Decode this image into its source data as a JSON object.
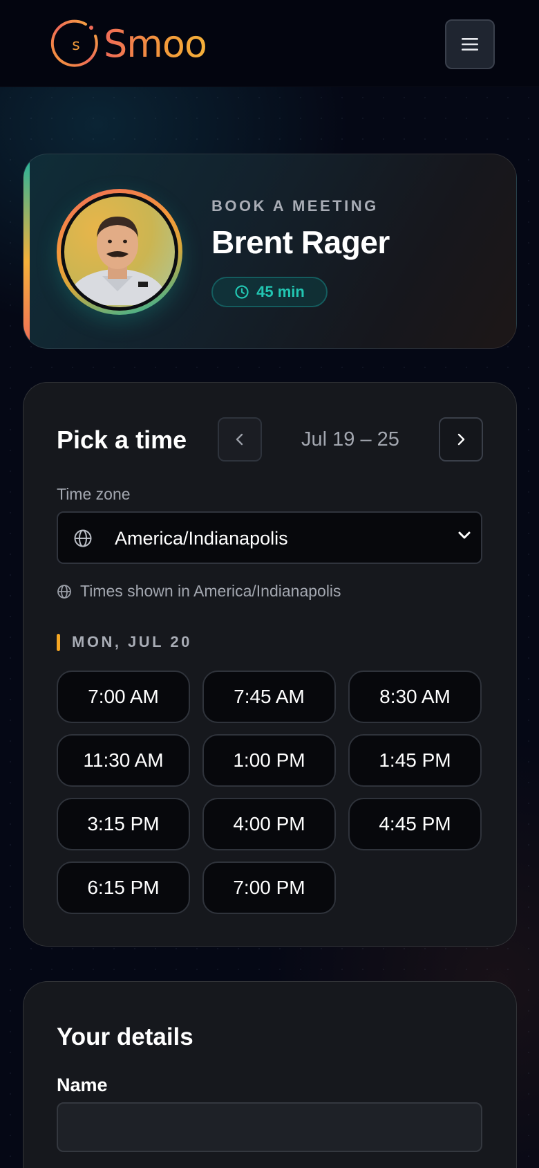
{
  "header": {
    "brand_name": "Smoo",
    "logo_letter": "s",
    "menu_icon": "hamburger-menu-icon",
    "brand_colors": [
      "#f06b58",
      "#f39a3a",
      "#f5b13a"
    ]
  },
  "host": {
    "eyebrow": "BOOK A MEETING",
    "name": "Brent Rager",
    "duration": "45 min",
    "duration_icon": "clock-icon",
    "accent_color": "#22c6b2"
  },
  "scheduler": {
    "title": "Pick a time",
    "week_range": "Jul 19 – 25",
    "prev_icon": "chevron-left-icon",
    "next_icon": "chevron-right-icon",
    "timezone_label": "Time zone",
    "timezone_value": "America/Indianapolis",
    "timezone_note": "Times shown in America/Indianapolis",
    "day_label": "MON, JUL 20",
    "slots": [
      "7:00 AM",
      "7:45 AM",
      "8:30 AM",
      "11:30 AM",
      "1:00 PM",
      "1:45 PM",
      "3:15 PM",
      "4:00 PM",
      "4:45 PM",
      "6:15 PM",
      "7:00 PM"
    ]
  },
  "details": {
    "title": "Your details",
    "name_label": "Name",
    "name_value": "",
    "name_placeholder": ""
  }
}
